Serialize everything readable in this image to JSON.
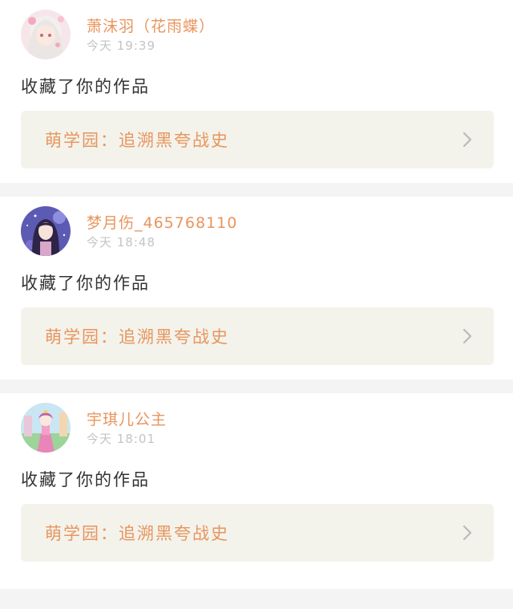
{
  "feed": {
    "items": [
      {
        "username": "萧沫羽（花雨蝶）",
        "time": "今天 19:39",
        "action": "收藏了你的作品",
        "work": "萌学园：追溯黑夸战史",
        "avatar": "avatar-girl-white-hair",
        "chevron_icon": "chevron-right-icon"
      },
      {
        "username": "梦月伤_465768110",
        "time": "今天 18:48",
        "action": "收藏了你的作品",
        "work": "萌学园：追溯黑夸战史",
        "avatar": "avatar-girl-dark-hair",
        "chevron_icon": "chevron-right-icon"
      },
      {
        "username": "宇琪儿公主",
        "time": "今天 18:01",
        "action": "收藏了你的作品",
        "work": "萌学园：追溯黑夸战史",
        "avatar": "avatar-princess-pink-dress",
        "chevron_icon": "chevron-right-icon"
      }
    ]
  },
  "colors": {
    "accent": "#e8955d",
    "timestamp": "#c4c4c4",
    "work_bg": "#f3f3ec",
    "page_bg": "#f4f4f4"
  }
}
